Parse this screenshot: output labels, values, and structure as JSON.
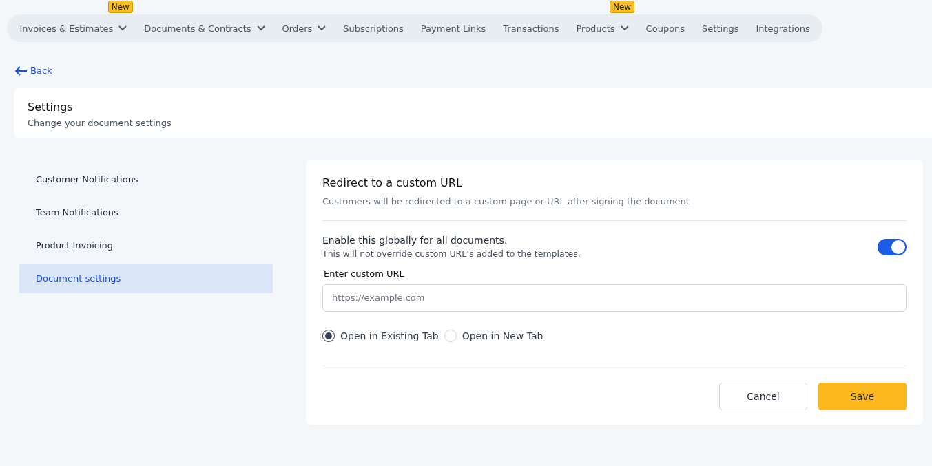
{
  "nav": [
    {
      "label": "Invoices & Estimates",
      "dropdown": true,
      "badge": "New"
    },
    {
      "label": "Documents & Contracts",
      "dropdown": true
    },
    {
      "label": "Orders",
      "dropdown": true
    },
    {
      "label": "Subscriptions",
      "dropdown": false
    },
    {
      "label": "Payment Links",
      "dropdown": false
    },
    {
      "label": "Transactions",
      "dropdown": false
    },
    {
      "label": "Products",
      "dropdown": true,
      "badge": "New"
    },
    {
      "label": "Coupons",
      "dropdown": false
    },
    {
      "label": "Settings",
      "dropdown": false
    },
    {
      "label": "Integrations",
      "dropdown": false
    }
  ],
  "back": "Back",
  "header": {
    "title": "Settings",
    "subtitle": "Change your document settings"
  },
  "sidebar": {
    "items": [
      {
        "label": "Customer Notifications",
        "selected": false
      },
      {
        "label": "Team Notifications",
        "selected": false
      },
      {
        "label": "Product Invoicing",
        "selected": false
      },
      {
        "label": "Document settings",
        "selected": true
      }
    ]
  },
  "panel": {
    "title": "Redirect to a custom URL",
    "description": "Customers will be redirected to a custom page or URL after signing the document",
    "toggle": {
      "label": "Enable this globally for all documents.",
      "hint": "This will not override custom URL’s added to the templates.",
      "on": true
    },
    "url_field": {
      "label": "Enter custom URL",
      "placeholder": "https://example.com"
    },
    "options": [
      {
        "label": "Open in Existing Tab",
        "selected": true
      },
      {
        "label": "Open in New Tab",
        "selected": false
      }
    ],
    "buttons": [
      {
        "label": "Cancel",
        "kind": "secondary"
      },
      {
        "label": "Save",
        "kind": "primary"
      }
    ]
  }
}
